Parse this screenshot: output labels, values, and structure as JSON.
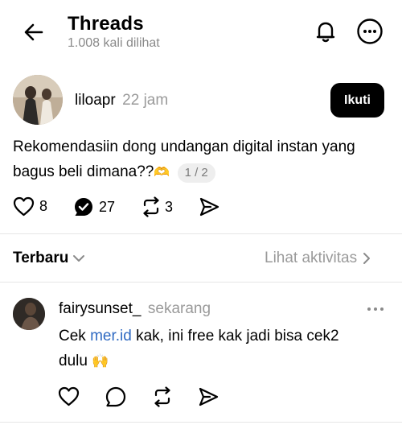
{
  "header": {
    "title": "Threads",
    "views": "1.008 kali dilihat"
  },
  "post": {
    "username": "liloapr",
    "time": "22 jam",
    "follow_label": "Ikuti",
    "text": "Rekomendasiin dong undangan digital instan yang bagus beli dimana??",
    "emoji": "🫶",
    "page_indicator": "1 / 2",
    "likes": "8",
    "comments": "27",
    "reposts": "3"
  },
  "sort": {
    "label": "Terbaru",
    "activity_label": "Lihat aktivitas"
  },
  "reply": {
    "username": "fairysunset_",
    "time": "sekarang",
    "text_before_link": "Cek ",
    "link_text": "mer.id",
    "text_after_link": " kak, ini free kak jadi bisa cek2",
    "text_line2": "dulu",
    "emoji": "🙌"
  }
}
